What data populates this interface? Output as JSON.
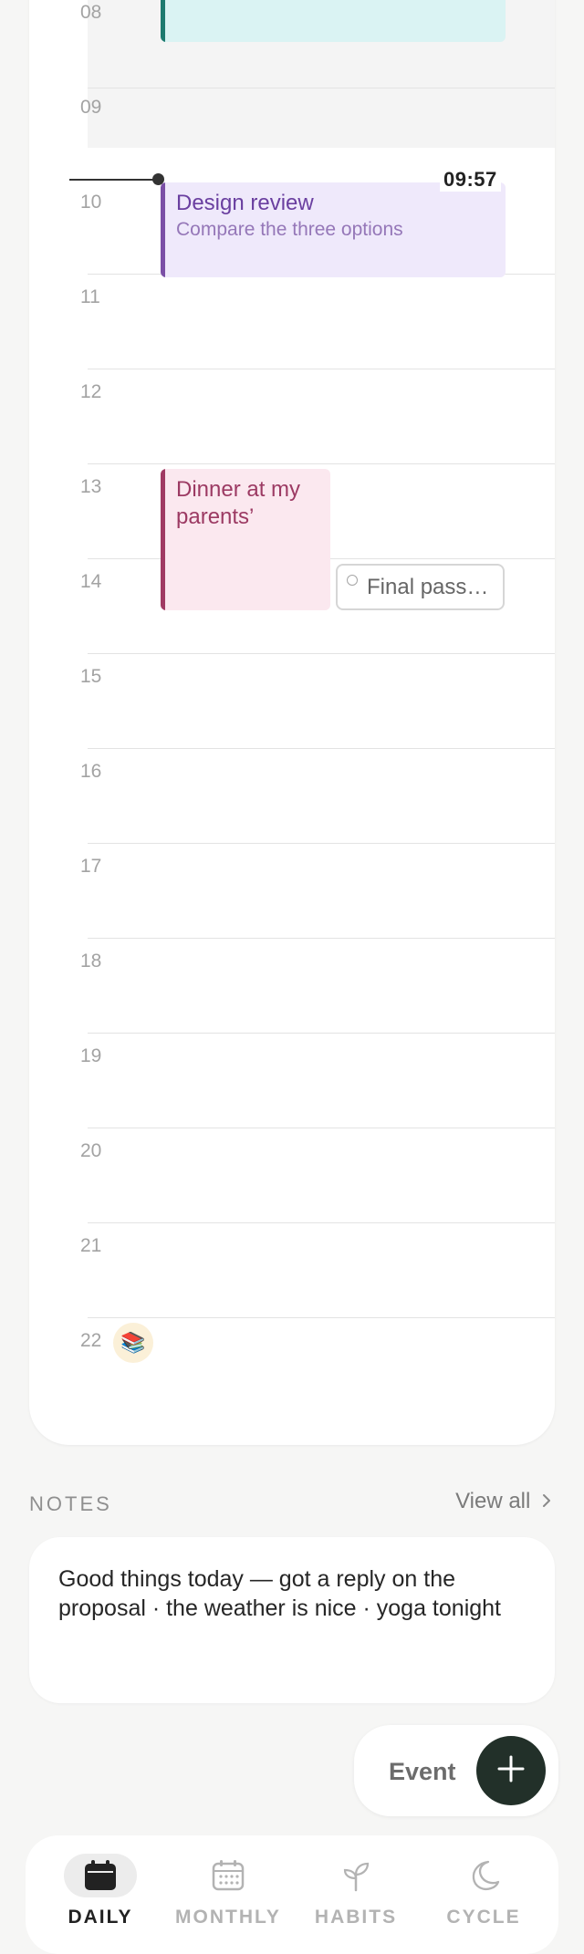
{
  "calendar": {
    "hours": [
      "08",
      "09",
      "10",
      "11",
      "12",
      "13",
      "14",
      "15",
      "16",
      "17",
      "18",
      "19",
      "20",
      "21",
      "22"
    ],
    "now_time": "09:57",
    "events": [
      {
        "title": "",
        "subtitle": "",
        "bar_color": "#1d7a6f",
        "bg_color": "#daf3f3"
      },
      {
        "title": "Design review",
        "subtitle": "Compare the three options",
        "bar_color": "#7b4fa6",
        "bg_color": "#efe9fb",
        "title_color": "#6a3fa0",
        "subtitle_color": "#9577b8"
      },
      {
        "title": "Dinner at my parents’",
        "subtitle": "",
        "bar_color": "#a03a63",
        "bg_color": "#fbe8ef",
        "title_color": "#9c3a63"
      }
    ],
    "task": {
      "label": "Final pass…"
    },
    "emoji": "📚"
  },
  "notes": {
    "heading": "NOTES",
    "view_all": "View all",
    "text": "Good things today — got a reply on the proposal · the weather is nice · yoga tonight"
  },
  "fab": {
    "label": "Event"
  },
  "nav": {
    "items": [
      {
        "label": "DAILY",
        "icon": "calendar-day-icon",
        "active": true
      },
      {
        "label": "MONTHLY",
        "icon": "calendar-grid-icon",
        "active": false
      },
      {
        "label": "HABITS",
        "icon": "sprout-icon",
        "active": false
      },
      {
        "label": "CYCLE",
        "icon": "moon-icon",
        "active": false
      }
    ]
  },
  "colors": {
    "accent_dark": "#223029",
    "inactive_nav": "#b3b3b3",
    "active_nav": "#222222"
  }
}
